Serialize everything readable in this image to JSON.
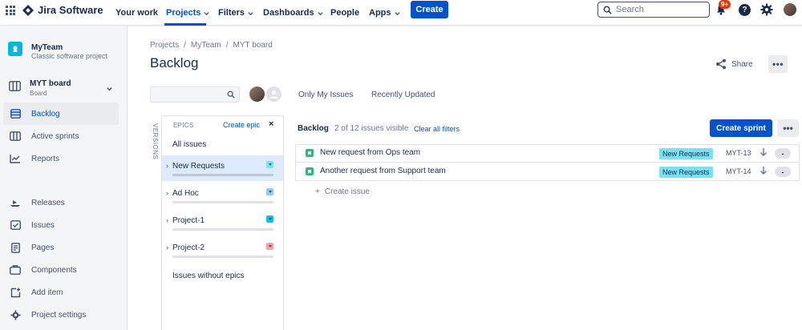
{
  "nav": {
    "logo": "Jira Software",
    "items": [
      {
        "label": "Your work",
        "chevron": false
      },
      {
        "label": "Projects",
        "chevron": true,
        "active": true
      },
      {
        "label": "Filters",
        "chevron": true
      },
      {
        "label": "Dashboards",
        "chevron": true
      },
      {
        "label": "People",
        "chevron": false
      },
      {
        "label": "Apps",
        "chevron": true
      }
    ],
    "create_label": "Create",
    "search_placeholder": "Search",
    "notifications_badge": "9+",
    "help_glyph": "?"
  },
  "sidebar": {
    "project_name": "MyTeam",
    "project_type": "Classic software project",
    "board_name": "MYT board",
    "board_sub": "Board",
    "items": [
      {
        "label": "Backlog",
        "icon": "backlog-icon",
        "active": true
      },
      {
        "label": "Active sprints",
        "icon": "active-sprints-icon"
      },
      {
        "label": "Reports",
        "icon": "reports-icon"
      },
      {
        "label": "Releases",
        "icon": "releases-icon"
      },
      {
        "label": "Issues",
        "icon": "issues-icon"
      },
      {
        "label": "Pages",
        "icon": "pages-icon"
      },
      {
        "label": "Components",
        "icon": "components-icon"
      },
      {
        "label": "Add item",
        "icon": "add-item-icon"
      },
      {
        "label": "Project settings",
        "icon": "settings-icon"
      }
    ]
  },
  "breadcrumb": [
    "Projects",
    "MyTeam",
    "MYT board"
  ],
  "breadcrumb_sep": "/",
  "page_title": "Backlog",
  "share_label": "Share",
  "more_glyph": "•••",
  "quick_filters": [
    "Only My Issues",
    "Recently Updated"
  ],
  "versions_label": "VERSIONS",
  "epics": {
    "header": "EPICS",
    "create_label": "Create epic",
    "close_glyph": "×",
    "all_issues": "All issues",
    "chevron_glyph": "›",
    "items": [
      {
        "name": "New Requests",
        "color": "#79E2F2",
        "selected": true
      },
      {
        "name": "Ad Hoc",
        "color": "#8ECBF5"
      },
      {
        "name": "Project-1",
        "color": "#00C7E6"
      },
      {
        "name": "Project-2",
        "color": "#F5A3A3"
      }
    ],
    "without_epics": "Issues without epics"
  },
  "backlog": {
    "title": "Backlog",
    "count_text": "2 of 12 issues visible",
    "clear_filters": "Clear all filters",
    "create_sprint": "Create sprint",
    "issues": [
      {
        "summary": "New request from Ops team",
        "epic": "New Requests",
        "key": "MYT-13",
        "estimate": "-"
      },
      {
        "summary": "Another request from Support team",
        "epic": "New Requests",
        "key": "MYT-14",
        "estimate": "-"
      }
    ],
    "create_issue": "Create issue",
    "create_issue_glyph": "+"
  },
  "colors": {
    "primary": "#0052CC",
    "story": "#36B37E",
    "epic_lozenge": "#79E2F2",
    "badge": "#DE350B"
  }
}
